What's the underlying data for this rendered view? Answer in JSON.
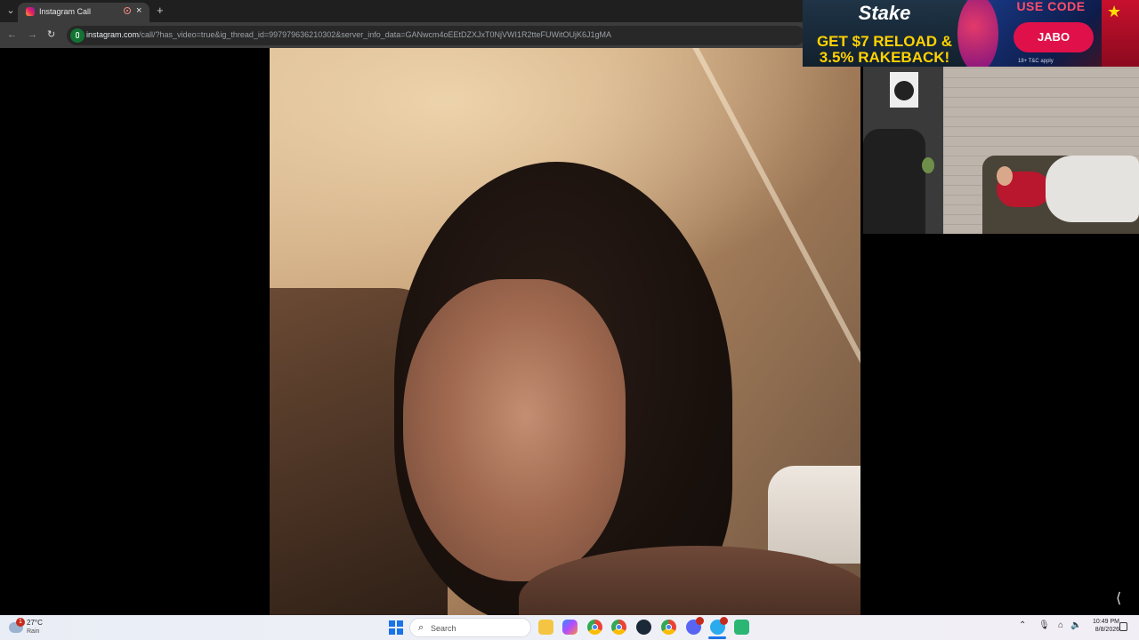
{
  "browser": {
    "tab_title": "Instagram Call",
    "new_tab_symbol": "+",
    "url_host": "instagram.com",
    "url_path": "/call/?has_video=true&ig_thread_id=997979636210302&server_info_data=GANwcm4oEEtDZXJxT0NjVWI1R2tteFUWitOUjK6J1gMA"
  },
  "ad": {
    "brand": "Stake",
    "headline": "GET $7 RELOAD & 3.5% RAKEBACK!",
    "code_label": "USE CODE",
    "code": "JABO",
    "terms": "18+ T&C apply"
  },
  "taskbar": {
    "weather_temp": "27°C",
    "weather_desc": "Rain",
    "weather_badge": "1",
    "search_placeholder": "Search",
    "time": "10:49 PM",
    "date": "8/8/2026"
  },
  "icons": [
    "instagram-icon",
    "recording-icon",
    "close-icon",
    "back-icon",
    "forward-icon",
    "reload-icon",
    "site-info-icon",
    "windows-start-icon",
    "search-icon",
    "file-explorer-icon",
    "copilot-icon",
    "chrome-icon",
    "steam-icon",
    "discord-icon",
    "telegram-icon",
    "chevron-up-icon",
    "microphone-icon",
    "network-icon",
    "volume-icon",
    "notification-icon"
  ],
  "colors": {
    "tab_bg": "#3c3c3c",
    "toolbar_bg": "#3c3c3c",
    "ad_accent": "#e0114a",
    "ad_yellow": "#ffd200"
  }
}
